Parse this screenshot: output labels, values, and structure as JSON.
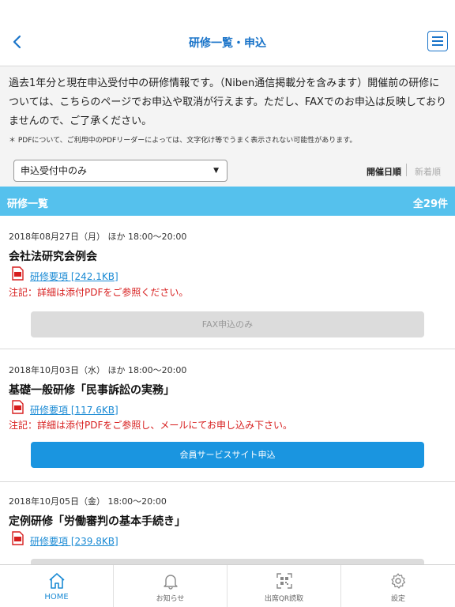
{
  "header": {
    "title": "研修一覧・申込"
  },
  "info": {
    "text": "過去1年分と現在申込受付中の研修情報です。（Niben通信掲載分を含みます）開催前の研修については、こちらのページでお申込や取消が行えます。ただし、FAXでのお申込は反映しておりませんので、ご了承ください。",
    "pdf_note": "＊ PDFについて、ご利用中のPDFリーダーによっては、文字化け等でうまく表示されない可能性があります。",
    "filter_value": "申込受付中のみ",
    "sort_date": "開催日順",
    "sort_new": "新着順"
  },
  "list": {
    "title": "研修一覧",
    "count": "全29件"
  },
  "items": [
    {
      "date": "2018年08月27日（月） ほか 18:00〜20:00",
      "title": "会社法研究会例会",
      "pdf": "研修要項 [242.1KB]",
      "note": "注記：詳細は添付PDFをご参照ください。",
      "button": "FAX申込のみ"
    },
    {
      "date": "2018年10月03日（水） ほか 18:00〜20:00",
      "title": "基礎一般研修「民事訴訟の実務」",
      "pdf": "研修要項 [117.6KB]",
      "note": "注記：詳細は添付PDFをご参照し、メールにてお申し込み下さい。",
      "button": "会員サービスサイト申込"
    },
    {
      "date": "2018年10月05日（金） 18:00〜20:00",
      "title": "定例研修「労働審判の基本手続き」",
      "pdf": "研修要項 [239.8KB]"
    }
  ],
  "tabs": [
    {
      "label": "HOME",
      "icon": "home-icon"
    },
    {
      "label": "お知らせ",
      "icon": "bell-icon"
    },
    {
      "label": "出席QR読取",
      "icon": "qr-icon"
    },
    {
      "label": "設定",
      "icon": "gear-icon"
    }
  ],
  "colors": {
    "accent": "#1a74c9",
    "list_bar": "#55c1ed",
    "primary_button": "#1a95e0",
    "note_red": "#d71e1e"
  }
}
